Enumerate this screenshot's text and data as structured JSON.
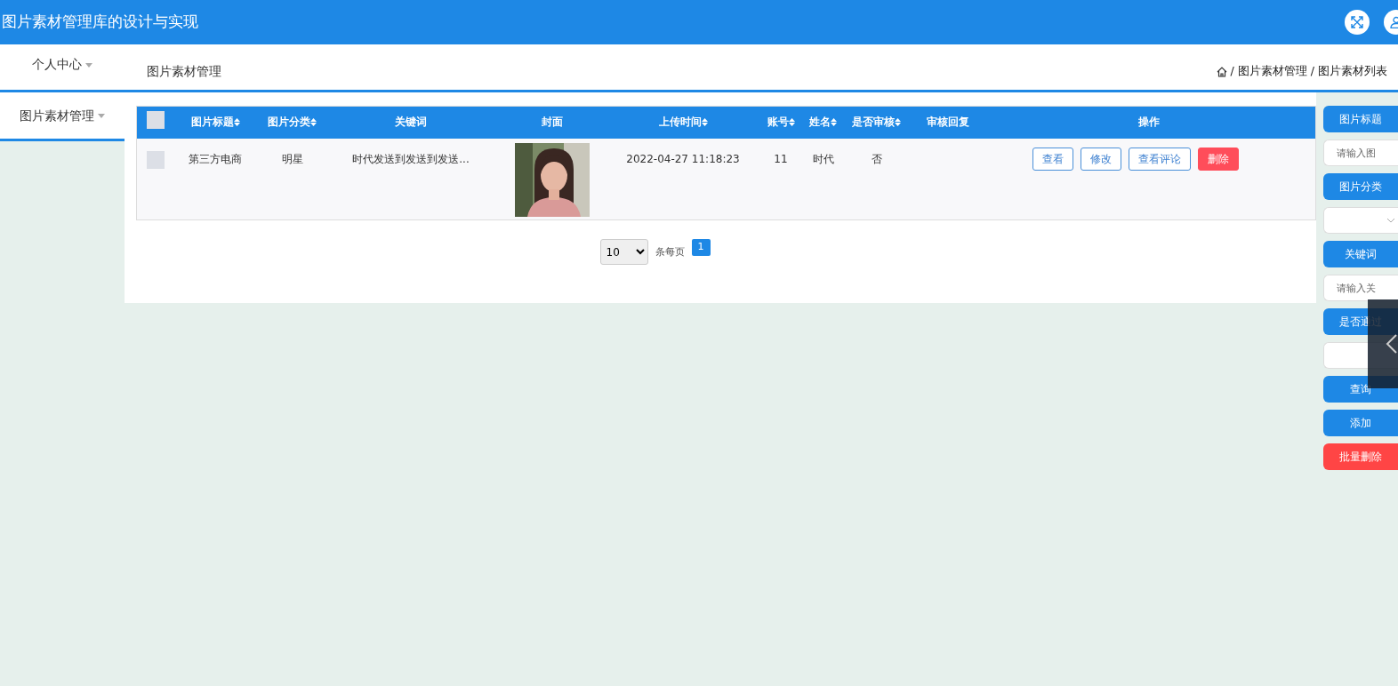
{
  "header": {
    "title": "图片素材管理库的设计与实现"
  },
  "topbar": {
    "menu": "个人中心",
    "page_title": "图片素材管理",
    "breadcrumb": [
      "图片素材管理",
      "图片素材列表"
    ],
    "separator": "/"
  },
  "sidebar": {
    "items": [
      {
        "label": "图片素材管理",
        "selected": true
      }
    ]
  },
  "table": {
    "select_all_checked": false,
    "columns": [
      {
        "label": "图片标题",
        "sortable": true
      },
      {
        "label": "图片分类",
        "sortable": true
      },
      {
        "label": "关键词",
        "sortable": false
      },
      {
        "label": "封面",
        "sortable": false
      },
      {
        "label": "上传时间",
        "sortable": true
      },
      {
        "label": "账号",
        "sortable": true
      },
      {
        "label": "姓名",
        "sortable": true
      },
      {
        "label": "是否审核",
        "sortable": true
      },
      {
        "label": "审核回复",
        "sortable": false
      },
      {
        "label": "操作",
        "sortable": false
      }
    ],
    "rows": [
      {
        "checked": false,
        "cells": [
          "第三方电商",
          "明星",
          "时代发送到发送到发送...",
          {
            "kind": "picture"
          },
          "2022-04-27 11:18:23",
          "11",
          "时代",
          "否",
          ""
        ],
        "actions": [
          {
            "label": "查看",
            "kind": "outline"
          },
          {
            "label": "修改",
            "kind": "outline"
          },
          {
            "label": "查看评论",
            "kind": "outline"
          },
          {
            "label": "删除",
            "kind": "danger"
          }
        ]
      }
    ]
  },
  "pagination": {
    "page_size": "10",
    "page_size_label": "条每页",
    "pages": [
      {
        "label": "1",
        "selected": true
      }
    ]
  },
  "filters": [
    {
      "kind": "label",
      "label": "图片标题"
    },
    {
      "kind": "input",
      "placeholder": "请输入图"
    },
    {
      "kind": "label",
      "label": "图片分类"
    },
    {
      "kind": "select"
    },
    {
      "kind": "label",
      "label": "关键词"
    },
    {
      "kind": "input",
      "placeholder": "请输入关"
    },
    {
      "kind": "label",
      "label": "是否通过"
    },
    {
      "kind": "select-plain"
    },
    {
      "kind": "button",
      "label": "查询"
    },
    {
      "kind": "button",
      "label": "添加"
    },
    {
      "kind": "danger",
      "label": "批量删除"
    }
  ]
}
